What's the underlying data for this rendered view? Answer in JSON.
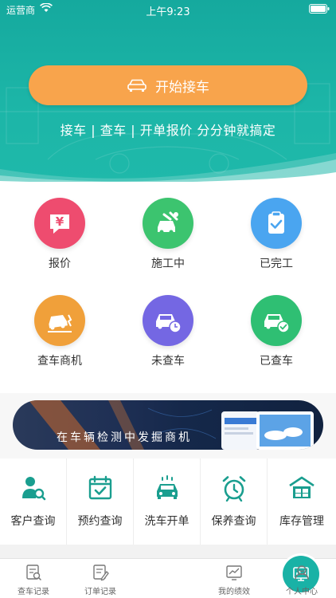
{
  "status": {
    "carrier": "运营商",
    "time": "上午9:23"
  },
  "hero": {
    "start_button": "开始接车",
    "slogan": "接车 | 查车 | 开单报价  分分钟就搞定"
  },
  "grid": [
    {
      "label": "报价",
      "icon": "yen-chat-icon",
      "color": "#ee4c6f"
    },
    {
      "label": "施工中",
      "icon": "car-repair-icon",
      "color": "#3cc46f"
    },
    {
      "label": "已完工",
      "icon": "clipboard-check-icon",
      "color": "#4aa5f0"
    },
    {
      "label": "查车商机",
      "icon": "car-crash-icon",
      "color": "#f0a03a"
    },
    {
      "label": "未查车",
      "icon": "car-clock-icon",
      "color": "#7467e3"
    },
    {
      "label": "已查车",
      "icon": "car-check-icon",
      "color": "#2fbf73"
    }
  ],
  "banner": {
    "text": "在车辆检测中发掘商机"
  },
  "tools": [
    {
      "label": "客户查询",
      "icon": "customer-search-icon"
    },
    {
      "label": "预约查询",
      "icon": "calendar-check-icon"
    },
    {
      "label": "洗车开单",
      "icon": "car-wash-icon"
    },
    {
      "label": "保养查询",
      "icon": "alarm-clock-icon"
    },
    {
      "label": "库存管理",
      "icon": "warehouse-icon"
    }
  ],
  "tabs": [
    {
      "label": "查车记录",
      "icon": "car-record-icon"
    },
    {
      "label": "订单记录",
      "icon": "order-record-icon"
    },
    {
      "label": "",
      "icon": "dashboard-icon"
    },
    {
      "label": "我的绩效",
      "icon": "performance-chart-icon"
    },
    {
      "label": "个人中心",
      "icon": "person-icon"
    }
  ],
  "colors": {
    "teal": "#19b2a6",
    "orange": "#f8a44c",
    "tool_icon": "#1a9e8f"
  }
}
